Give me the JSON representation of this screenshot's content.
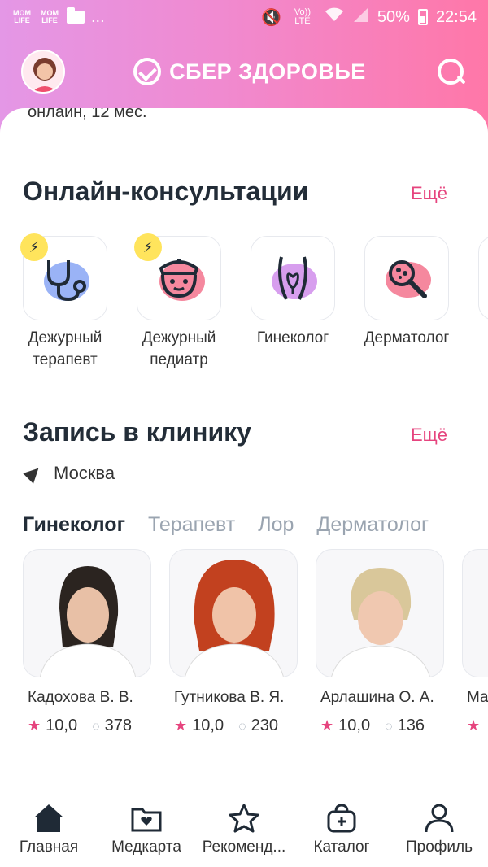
{
  "status_bar": {
    "left_icons": [
      "MOM LIFE",
      "MOM LIFE"
    ],
    "dots": "...",
    "battery": "50%",
    "time": "22:54",
    "signal_text": "Vo)) LTE"
  },
  "header": {
    "logo_text": "СБЕР ЗДОРОВЬЕ"
  },
  "cut_text": "онлайн, 12 мес.",
  "consultations": {
    "title": "Онлайн-консультации",
    "more": "Ещё",
    "items": [
      {
        "label": "Дежурный терапевт",
        "icon": "stethoscope-icon",
        "urgent": true
      },
      {
        "label": "Дежурный педиатр",
        "icon": "pediatrician-icon",
        "urgent": true
      },
      {
        "label": "Гинеколог",
        "icon": "gynecology-icon",
        "urgent": false
      },
      {
        "label": "Дерматолог",
        "icon": "dermatology-icon",
        "urgent": false
      }
    ]
  },
  "clinic": {
    "title": "Запись в клинику",
    "more": "Ещё",
    "city": "Москва",
    "tabs": [
      "Гинеколог",
      "Терапевт",
      "Лор",
      "Дерматолог"
    ],
    "active_tab": "Гинеколог",
    "doctors": [
      {
        "name": "Кадохова В. В.",
        "rating": "10,0",
        "reviews": "378"
      },
      {
        "name": "Гутникова В. Я.",
        "rating": "10,0",
        "reviews": "230"
      },
      {
        "name": "Арлашина О. А.",
        "rating": "10,0",
        "reviews": "136"
      },
      {
        "name": "Ма",
        "rating": "",
        "reviews": ""
      }
    ]
  },
  "bottom_nav": [
    {
      "label": "Главная",
      "icon": "home-icon",
      "active": true
    },
    {
      "label": "Медкарта",
      "icon": "medcard-icon",
      "active": false
    },
    {
      "label": "Рекоменд...",
      "icon": "star-icon",
      "active": false
    },
    {
      "label": "Каталог",
      "icon": "bag-icon",
      "active": false
    },
    {
      "label": "Профиль",
      "icon": "profile-icon",
      "active": false
    }
  ],
  "colors": {
    "accent": "#e6447e",
    "header_gradient_start": "#e497e6",
    "header_gradient_end": "#ff77a8",
    "tab_inactive": "#9aa4b0"
  }
}
